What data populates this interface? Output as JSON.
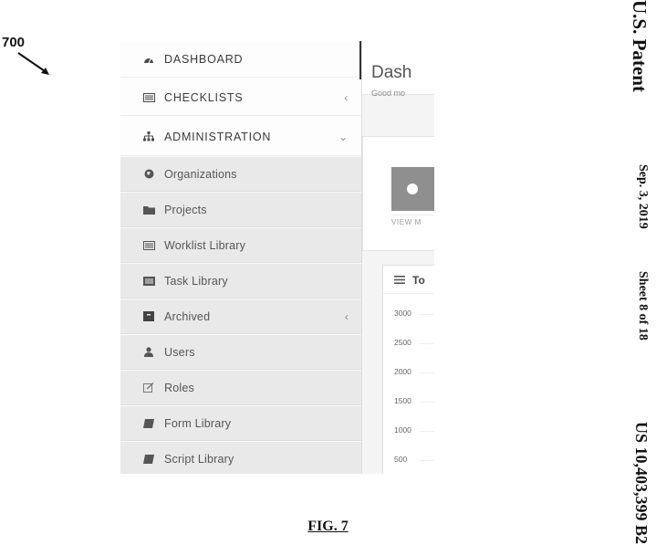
{
  "figure": {
    "reference_numeral": "700",
    "caption": "FIG. 7"
  },
  "patent_header": {
    "title": "U.S. Patent",
    "date": "Sep. 3, 2019",
    "sheet": "Sheet 8 of 18",
    "number": "US 10,403,399 B2"
  },
  "sidebar": {
    "top_items": [
      {
        "label": "DASHBOARD",
        "icon": "dashboard-icon"
      },
      {
        "label": "CHECKLISTS",
        "icon": "list-icon",
        "chevron": "‹"
      },
      {
        "label": "ADMINISTRATION",
        "icon": "sitemap-icon",
        "chevron": "⌄"
      }
    ],
    "sub_items": [
      {
        "label": "Organizations",
        "icon": "globe-icon"
      },
      {
        "label": "Projects",
        "icon": "folder-icon"
      },
      {
        "label": "Worklist Library",
        "icon": "list-icon"
      },
      {
        "label": "Task Library",
        "icon": "tasks-icon"
      },
      {
        "label": "Archived",
        "icon": "archive-icon",
        "chevron": "‹"
      },
      {
        "label": "Users",
        "icon": "user-icon"
      },
      {
        "label": "Roles",
        "icon": "edit-icon"
      },
      {
        "label": "Form Library",
        "icon": "book-icon"
      },
      {
        "label": "Script Library",
        "icon": "book-icon"
      }
    ]
  },
  "main": {
    "title": "Dash",
    "subtitle": "Good mo",
    "info_box_link": "VIEW M",
    "chart_title": "To"
  },
  "chart_data": {
    "type": "bar",
    "title": "To",
    "ytick_labels": [
      "3000",
      "2500",
      "2000",
      "1500",
      "1000",
      "500"
    ],
    "ylim": [
      0,
      3000
    ],
    "grid": true
  }
}
